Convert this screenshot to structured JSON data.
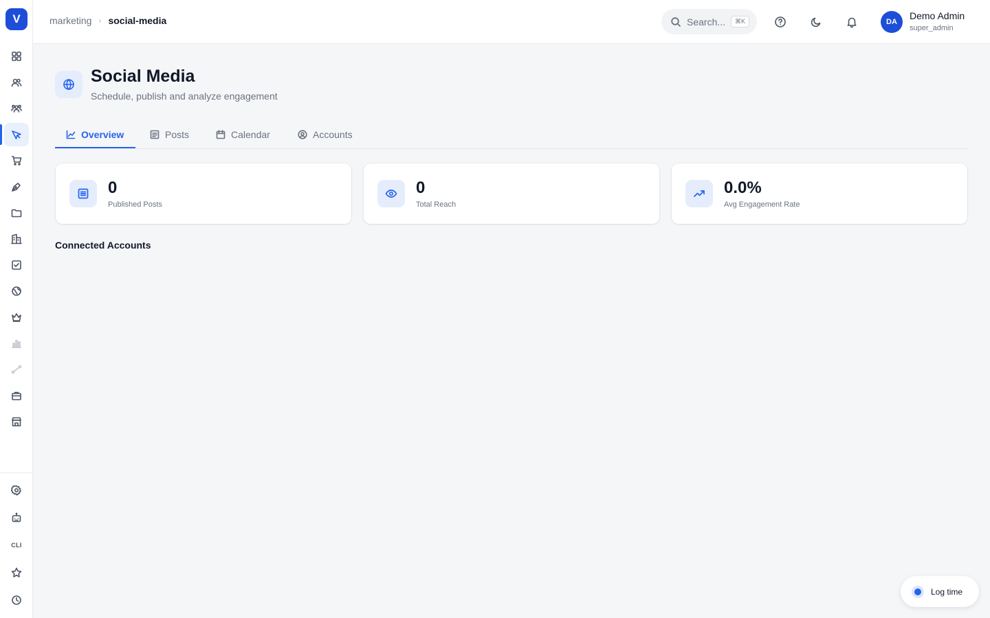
{
  "brand": {
    "logo_letter": "V",
    "accent": "#2563eb"
  },
  "sidebar": {
    "items": [
      {
        "icon": "dashboard-grid-icon"
      },
      {
        "icon": "contacts-icon"
      },
      {
        "icon": "team-icon"
      },
      {
        "icon": "marketing-megaphone-icon",
        "active": true
      },
      {
        "icon": "shopping-cart-icon"
      },
      {
        "icon": "pen-tool-icon"
      },
      {
        "icon": "folder-icon"
      },
      {
        "icon": "building-icon"
      },
      {
        "icon": "checkbox-icon"
      },
      {
        "icon": "globe-icon"
      },
      {
        "icon": "crown-icon"
      },
      {
        "icon": "bar-chart-icon"
      },
      {
        "icon": "workflow-icon"
      },
      {
        "icon": "briefcase-icon"
      },
      {
        "icon": "store-icon"
      }
    ],
    "bottom_items": [
      {
        "icon": "settings-gear-icon"
      },
      {
        "icon": "bot-icon"
      },
      {
        "label": "CLI"
      },
      {
        "icon": "star-icon"
      },
      {
        "icon": "clock-icon"
      }
    ]
  },
  "header": {
    "breadcrumb": {
      "parent": "marketing",
      "current": "social-media"
    },
    "search": {
      "placeholder": "Search...",
      "shortcut": "⌘K"
    },
    "user": {
      "initials": "DA",
      "name": "Demo Admin",
      "role": "super_admin"
    }
  },
  "page": {
    "title": "Social Media",
    "subtitle": "Schedule, publish and analyze engagement"
  },
  "tabs": [
    {
      "label": "Overview",
      "active": true
    },
    {
      "label": "Posts"
    },
    {
      "label": "Calendar"
    },
    {
      "label": "Accounts"
    }
  ],
  "stats": [
    {
      "value": "0",
      "label": "Published Posts",
      "icon": "document-icon"
    },
    {
      "value": "0",
      "label": "Total Reach",
      "icon": "eye-icon"
    },
    {
      "value": "0.0%",
      "label": "Avg Engagement Rate",
      "icon": "trending-up-icon"
    }
  ],
  "sections": {
    "connected_accounts": "Connected Accounts"
  },
  "log_time": {
    "label": "Log time"
  }
}
